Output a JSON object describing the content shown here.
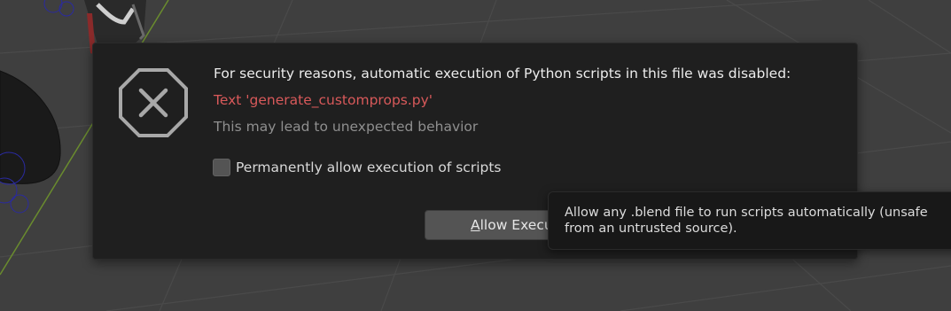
{
  "dialog": {
    "icon": "cancel-octagon-icon",
    "heading": "For security reasons, automatic execution of Python scripts in this file was disabled:",
    "script_name": "Text 'generate_customprops.py'",
    "subtext": "This may lead to unexpected behavior",
    "permanent_allow": {
      "label": "Permanently allow execution of scripts",
      "checked": false
    },
    "allow_button": {
      "accel_letter": "A",
      "label_rest": "llow Execu"
    }
  },
  "tooltip": {
    "line1": "Allow any .blend file to run scripts automatically (unsafe",
    "line2": "from an untrusted source)."
  },
  "colors": {
    "dialog_bg": "#1f1f1f",
    "script_name": "#d8595a",
    "viewport_bg": "#3f3f3f"
  }
}
